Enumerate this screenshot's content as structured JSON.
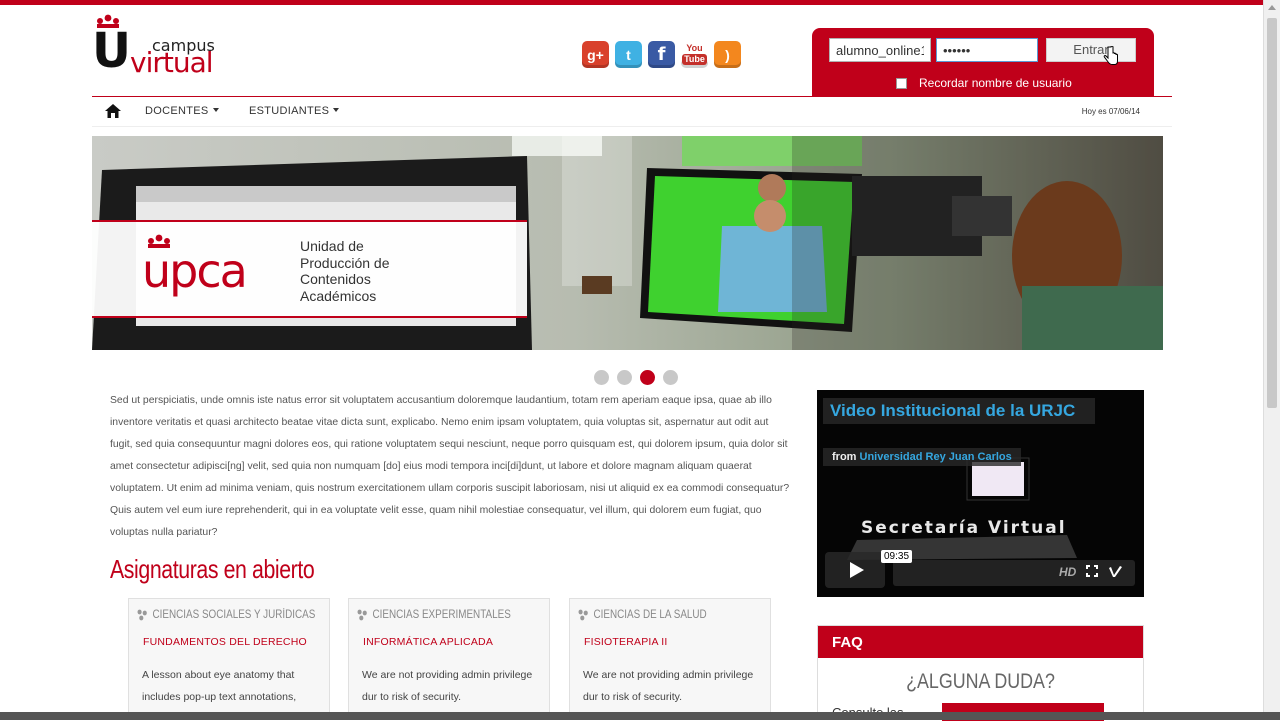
{
  "logo": {
    "top_word": "campus",
    "main_word": "virtual",
    "letter": "U"
  },
  "social": {
    "icons": [
      "google-plus-icon",
      "twitter-icon",
      "facebook-icon",
      "youtube-icon",
      "rss-icon"
    ],
    "gplus": "g+",
    "twitter": "t",
    "facebook": "f",
    "youtube_top": "You",
    "youtube_bottom": "Tube",
    "rss": ")"
  },
  "login": {
    "username": "alumno_online1",
    "password": "••••••",
    "submit": "Entrar",
    "remember": "Recordar nombre de usuario"
  },
  "nav": {
    "docentes": "DOCENTES",
    "estudiantes": "ESTUDIANTES",
    "date": "Hoy es 07/06/14"
  },
  "banner": {
    "brand": "upca",
    "line1": "Unidad de",
    "line2": "Producción de",
    "line3": "Contenidos",
    "line4": "Académicos",
    "slides": 4,
    "active_slide": 3
  },
  "intro": "Sed ut perspiciatis, unde omnis iste natus error sit voluptatem accusantium doloremque laudantium, totam rem aperiam eaque ipsa, quae ab illo inventore veritatis et quasi architecto beatae vitae dicta sunt, explicabo. Nemo enim ipsam voluptatem, quia voluptas sit, aspernatur aut odit aut fugit, sed quia consequuntur magni dolores eos, qui ratione voluptatem sequi nesciunt, neque porro quisquam est, qui dolorem ipsum, quia dolor sit amet consectetur adipisci[ng] velit, sed quia non numquam [do] eius modi tempora inci[di]dunt, ut labore et dolore magnam aliquam quaerat voluptatem. Ut enim ad minima veniam, quis nostrum exercitationem ullam corporis suscipit laboriosam, nisi ut aliquid ex ea commodi consequatur? Quis autem vel eum iure reprehenderit, qui in ea voluptate velit esse, quam nihil molestiae consequatur, vel illum, qui dolorem eum fugiat, quo voluptas nulla pariatur?",
  "section_title": "Asignaturas en abierto",
  "cards": [
    {
      "category": "CIENCIAS SOCIALES Y JURÍDICAS",
      "course": "FUNDAMENTOS DEL DERECHO",
      "desc": "A lesson about eye anatomy that includes pop-up text annotations,"
    },
    {
      "category": "CIENCIAS EXPERIMENTALES",
      "course": "INFORMÁTICA APLICADA",
      "desc": "We are not providing admin privilege dur to risk of security."
    },
    {
      "category": "CIENCIAS DE LA SALUD",
      "course": "FISIOTERAPIA II",
      "desc": "We are not providing admin privilege dur to risk of security."
    }
  ],
  "video": {
    "title": "Video Institucional de la URJC",
    "from_label": "from",
    "from_channel": "Universidad Rey Juan Carlos",
    "overlay": "Secretaría Virtual",
    "duration": "09:35",
    "hd": "HD"
  },
  "faq": {
    "header": "FAQ",
    "question": "¿ALGUNA DUDA?",
    "consult": "Consulte las"
  },
  "colors": {
    "accent": "#c0001a",
    "link_blue": "#35a7e0"
  }
}
